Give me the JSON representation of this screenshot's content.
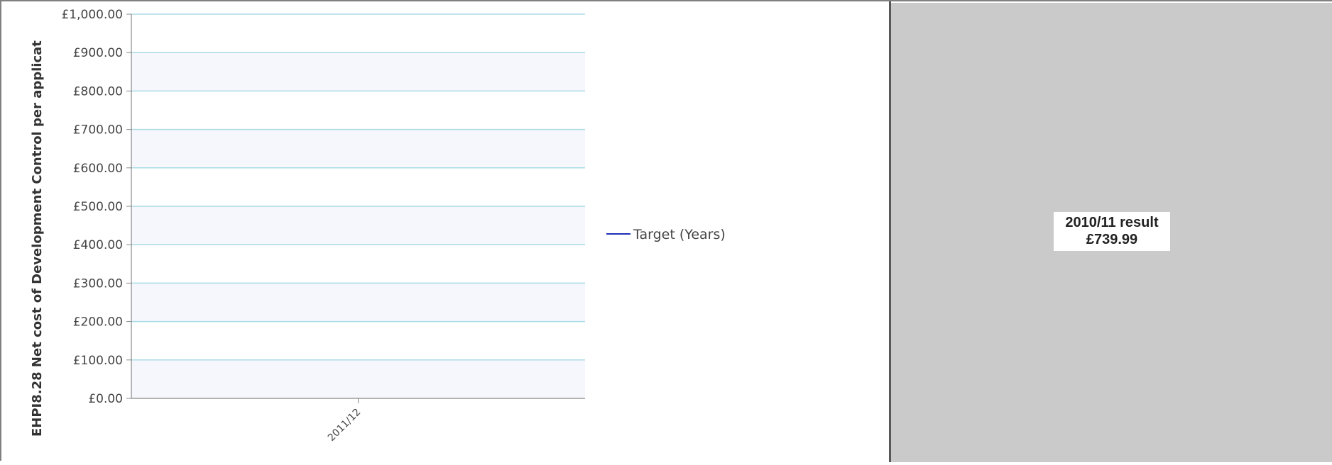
{
  "chart_data": {
    "type": "line",
    "ylabel": "EHPI8.28 Net cost of Development Control per applicat",
    "ylim": [
      0,
      1000
    ],
    "y_ticks": [
      "£0.00",
      "£100.00",
      "£200.00",
      "£300.00",
      "£400.00",
      "£500.00",
      "£600.00",
      "£700.00",
      "£800.00",
      "£900.00",
      "£1,000.00"
    ],
    "categories": [
      "2011/12"
    ],
    "series": [
      {
        "name": "Target (Years)",
        "color": "#1f2fb5",
        "values": []
      }
    ],
    "legend_position": "right",
    "grid": true,
    "colors": {
      "grid": "#a9dbe6",
      "band": "#f5f7fc",
      "axis": "#888888"
    }
  },
  "result": {
    "title": "2010/11 result",
    "value": "£739.99",
    "panel_color": "#cacaca"
  }
}
